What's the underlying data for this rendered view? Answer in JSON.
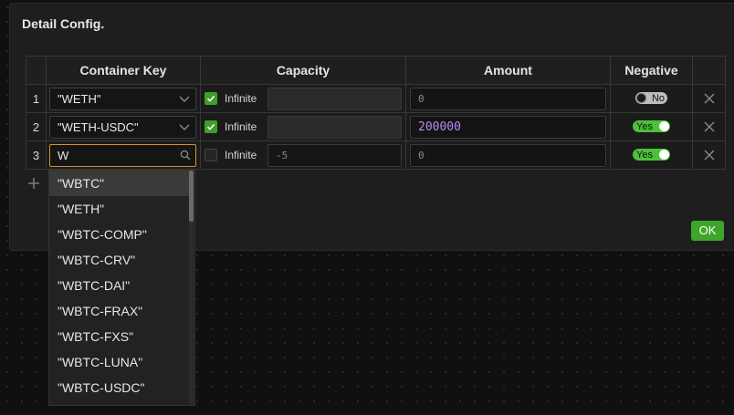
{
  "panel": {
    "title": "Detail Config."
  },
  "table": {
    "headers": {
      "index": "",
      "container_key": "Container Key",
      "capacity": "Capacity",
      "amount": "Amount",
      "negative": "Negative",
      "delete": ""
    },
    "rows": [
      {
        "index": "1",
        "key": "\"WETH\"",
        "infinite_checked": true,
        "infinite_label": "Infinite",
        "capacity": "",
        "amount": "0",
        "amount_filled": false,
        "negative": "No",
        "negative_on": false
      },
      {
        "index": "2",
        "key": "\"WETH-USDC\"",
        "infinite_checked": true,
        "infinite_label": "Infinite",
        "capacity": "",
        "amount": "200000",
        "amount_filled": true,
        "negative": "Yes",
        "negative_on": true
      },
      {
        "index": "3",
        "key": "W",
        "infinite_checked": false,
        "infinite_label": "Infinite",
        "capacity": "-5",
        "amount": "0",
        "amount_filled": false,
        "negative": "Yes",
        "negative_on": true
      }
    ]
  },
  "dropdown": {
    "items": [
      "\"WBTC\"",
      "\"WETH\"",
      "\"WBTC-COMP\"",
      "\"WBTC-CRV\"",
      "\"WBTC-DAI\"",
      "\"WBTC-FRAX\"",
      "\"WBTC-FXS\"",
      "\"WBTC-LUNA\"",
      "\"WBTC-USDC\""
    ],
    "highlighted_index": 0,
    "scroll_fraction": 0.22
  },
  "actions": {
    "ok_label": "OK"
  },
  "icons": {
    "chevron": "chevron-down-icon",
    "search": "search-icon",
    "delete": "close-icon",
    "add": "plus-icon",
    "check": "check-icon"
  },
  "colors": {
    "accent_green": "#3fa52a",
    "toggle_on": "#4bc238",
    "focus_orange": "#d9902f",
    "amount_purple": "#b78cf2"
  }
}
